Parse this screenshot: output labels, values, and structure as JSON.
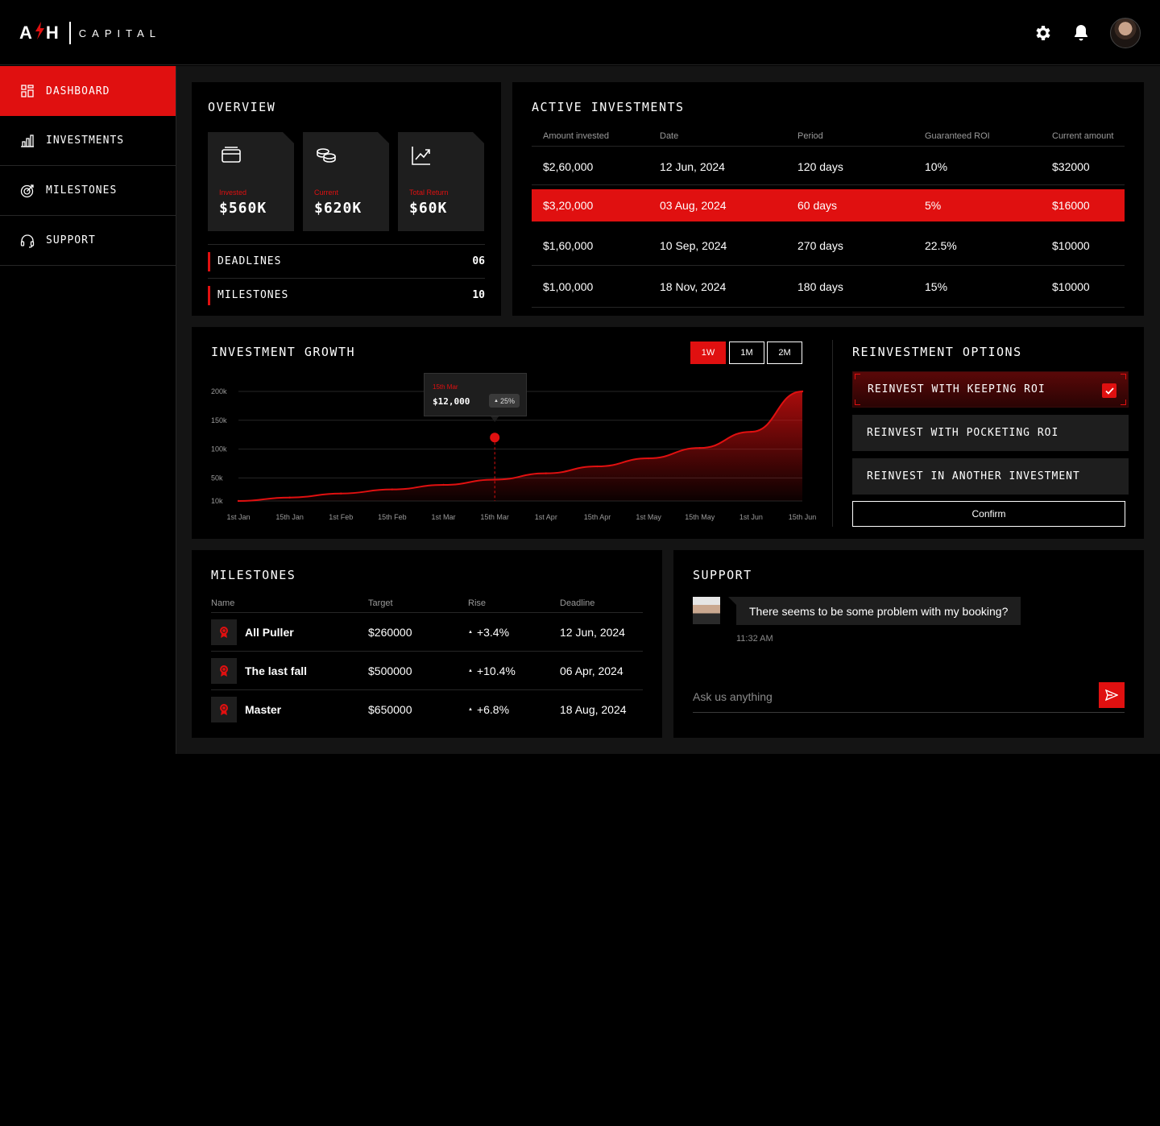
{
  "brand": {
    "mark_left": "A",
    "mark_right": "H",
    "name": "CAPITAL"
  },
  "header": {
    "settings_icon": "gear-icon",
    "notification_icon": "bell-icon"
  },
  "sidebar": {
    "items": [
      {
        "label": "DASHBOARD",
        "icon": "grid-icon",
        "active": true
      },
      {
        "label": "INVESTMENTS",
        "icon": "bar-chart-icon",
        "active": false
      },
      {
        "label": "MILESTONES",
        "icon": "target-icon",
        "active": false
      },
      {
        "label": "SUPPORT",
        "icon": "headset-icon",
        "active": false
      }
    ]
  },
  "overview": {
    "title": "OVERVIEW",
    "stats": [
      {
        "label": "Invested",
        "value": "$560K",
        "icon": "wallet-icon"
      },
      {
        "label": "Current",
        "value": "$620K",
        "icon": "coins-icon"
      },
      {
        "label": "Total Return",
        "value": "$60K",
        "icon": "trend-up-icon"
      }
    ],
    "rows": [
      {
        "label": "DEADLINES",
        "value": "06"
      },
      {
        "label": "MILESTONES",
        "value": "10"
      }
    ]
  },
  "active_investments": {
    "title": "ACTIVE INVESTMENTS",
    "columns": [
      "Amount invested",
      "Date",
      "Period",
      "Guaranteed ROI",
      "Current amount"
    ],
    "rows": [
      [
        "$2,60,000",
        "12 Jun, 2024",
        "120 days",
        "10%",
        "$32000"
      ],
      [
        "$3,20,000",
        "03 Aug, 2024",
        "60 days",
        "5%",
        "$16000"
      ],
      [
        "$1,60,000",
        "10 Sep, 2024",
        "270 days",
        "22.5%",
        "$10000"
      ],
      [
        "$1,00,000",
        "18 Nov, 2024",
        "180 days",
        "15%",
        "$10000"
      ]
    ],
    "selected_row": 1
  },
  "growth": {
    "title": "INVESTMENT GROWTH",
    "ranges": [
      "1W",
      "1M",
      "2M"
    ],
    "active_range": "1W",
    "tooltip": {
      "date": "15th Mar",
      "value": "$12,000",
      "change": "25%"
    }
  },
  "chart_data": {
    "type": "area",
    "x": [
      "1st Jan",
      "15th Jan",
      "1st Feb",
      "15th Feb",
      "1st Mar",
      "15th Mar",
      "1st Apr",
      "15th Apr",
      "1st May",
      "15th May",
      "1st Jun",
      "15th Jun"
    ],
    "y_ticks": [
      "200k",
      "150k",
      "100k",
      "50k",
      "10k"
    ],
    "series": [
      {
        "values": [
          10,
          16,
          23,
          30,
          38,
          47,
          58,
          70,
          84,
          102,
          130,
          200
        ]
      }
    ],
    "y_labels_vals": [
      200,
      150,
      100,
      50,
      10
    ],
    "highlight": {
      "x": "15th Mar",
      "y": 120
    },
    "grid": true,
    "color": "#e01010"
  },
  "reinvest": {
    "title": "REINVESTMENT OPTIONS",
    "options": [
      {
        "label": "REINVEST WITH KEEPING ROI",
        "selected": true
      },
      {
        "label": "REINVEST WITH POCKETING ROI",
        "selected": false
      },
      {
        "label": "REINVEST IN ANOTHER INVESTMENT",
        "selected": false
      }
    ],
    "confirm": "Confirm"
  },
  "milestones": {
    "title": "MILESTONES",
    "columns": [
      "Name",
      "Target",
      "Rise",
      "Deadline"
    ],
    "rows": [
      {
        "name": "All Puller",
        "target": "$260000",
        "rise": "+3.4%",
        "deadline": "12 Jun, 2024"
      },
      {
        "name": "The last fall",
        "target": "$500000",
        "rise": "+10.4%",
        "deadline": "06 Apr, 2024"
      },
      {
        "name": "Master",
        "target": "$650000",
        "rise": "+6.8%",
        "deadline": "18 Aug, 2024"
      }
    ]
  },
  "support": {
    "title": "SUPPORT",
    "message": "There seems to be some problem with my booking?",
    "time": "11:32 AM",
    "input_placeholder": "Ask us anything"
  },
  "colors": {
    "accent": "#e01010",
    "background": "#000000",
    "panel": "#1e1e1e",
    "main_bg": "#141414"
  }
}
